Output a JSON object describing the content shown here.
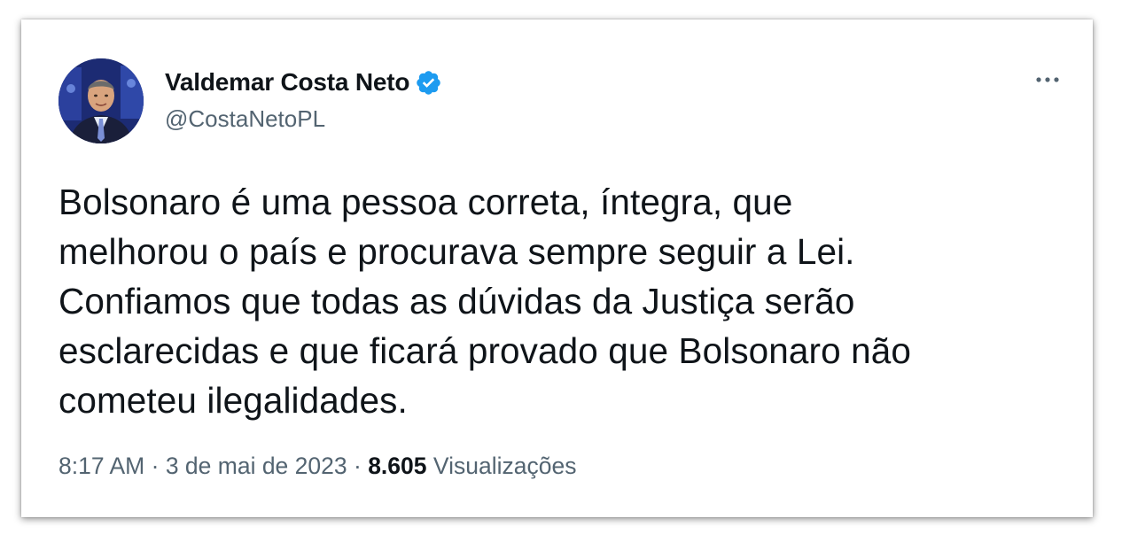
{
  "tweet": {
    "author": {
      "display_name": "Valdemar Costa Neto",
      "handle": "@CostaNetoPL",
      "verified": true,
      "avatar_icon": "profile-photo"
    },
    "more_icon": "ellipsis-icon",
    "text_lines": [
      "Bolsonaro é uma pessoa correta, íntegra, que",
      "melhorou o país e procurava sempre seguir a Lei.",
      "Confiamos que todas as dúvidas da Justiça serão",
      "esclarecidas e que ficará provado que Bolsonaro não",
      "cometeu ilegalidades."
    ],
    "meta": {
      "time": "8:17 AM",
      "separator": "·",
      "date": "3 de mai de 2023",
      "views_count": "8.605",
      "views_label": "Visualizações"
    }
  },
  "colors": {
    "text_primary": "#0f1419",
    "text_secondary": "#536471",
    "verified_blue": "#1d9bf0",
    "card_background": "#ffffff"
  }
}
